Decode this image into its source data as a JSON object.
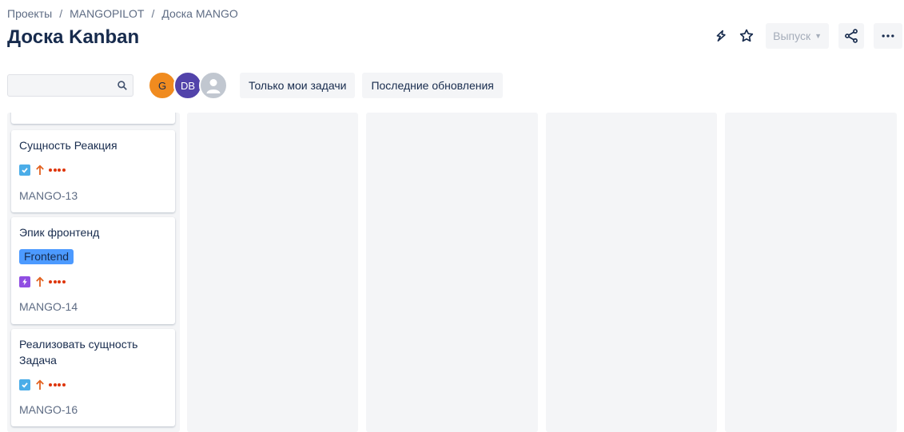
{
  "breadcrumb": [
    "Проекты",
    "MANGOPILOT",
    "Доска MANGO"
  ],
  "page_title": "Доска Kanban",
  "header_actions": {
    "automation_icon": "lightning-bolt-icon",
    "star_icon": "star-icon",
    "release_label": "Выпуск",
    "share_icon": "share-icon",
    "more_icon": "more-icon"
  },
  "search": {
    "value": "",
    "placeholder": ""
  },
  "avatars": [
    {
      "initials": "G",
      "color": "#f08b1f"
    },
    {
      "initials": "DB",
      "color": "#5243aa"
    },
    {
      "initials": "",
      "color": "#c1c7d0"
    }
  ],
  "quick_filters": [
    "Только мои задачи",
    "Последние обновления"
  ],
  "cards": [
    {
      "title": "Сущность Реакция",
      "type": "task",
      "priority": "high",
      "key": "MANGO-13"
    },
    {
      "title": "Эпик фронтенд",
      "label": "Frontend",
      "type": "epic",
      "priority": "high",
      "key": "MANGO-14"
    },
    {
      "title": "Реализовать сущность Задача",
      "type": "task",
      "priority": "high",
      "key": "MANGO-16"
    }
  ],
  "colors": {
    "accent": "#0052cc",
    "column_bg": "#f4f5f7",
    "priority_high": "#e2611f",
    "dots": "#de350b",
    "label_bg": "#4c9aff"
  }
}
